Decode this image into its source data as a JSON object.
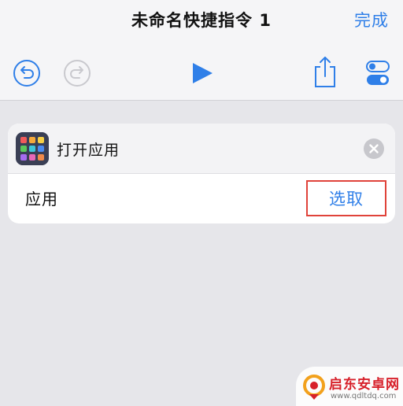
{
  "header": {
    "title": "未命名快捷指令 1",
    "done_label": "完成"
  },
  "toolbar": {
    "undo_icon": "undo-icon",
    "redo_icon": "redo-icon",
    "play_icon": "play-icon",
    "share_icon": "share-icon",
    "settings_icon": "toggle-settings-icon"
  },
  "action_card": {
    "title": "打开应用",
    "icon": "app-grid-icon",
    "parameter_label": "应用",
    "choose_label": "选取"
  },
  "watermark": {
    "title": "启东安卓网",
    "url": "www.qdltdq.com"
  },
  "colors": {
    "accent": "#2f7fe8",
    "highlight_box": "#e0433a",
    "background": "#e6e6ea"
  }
}
